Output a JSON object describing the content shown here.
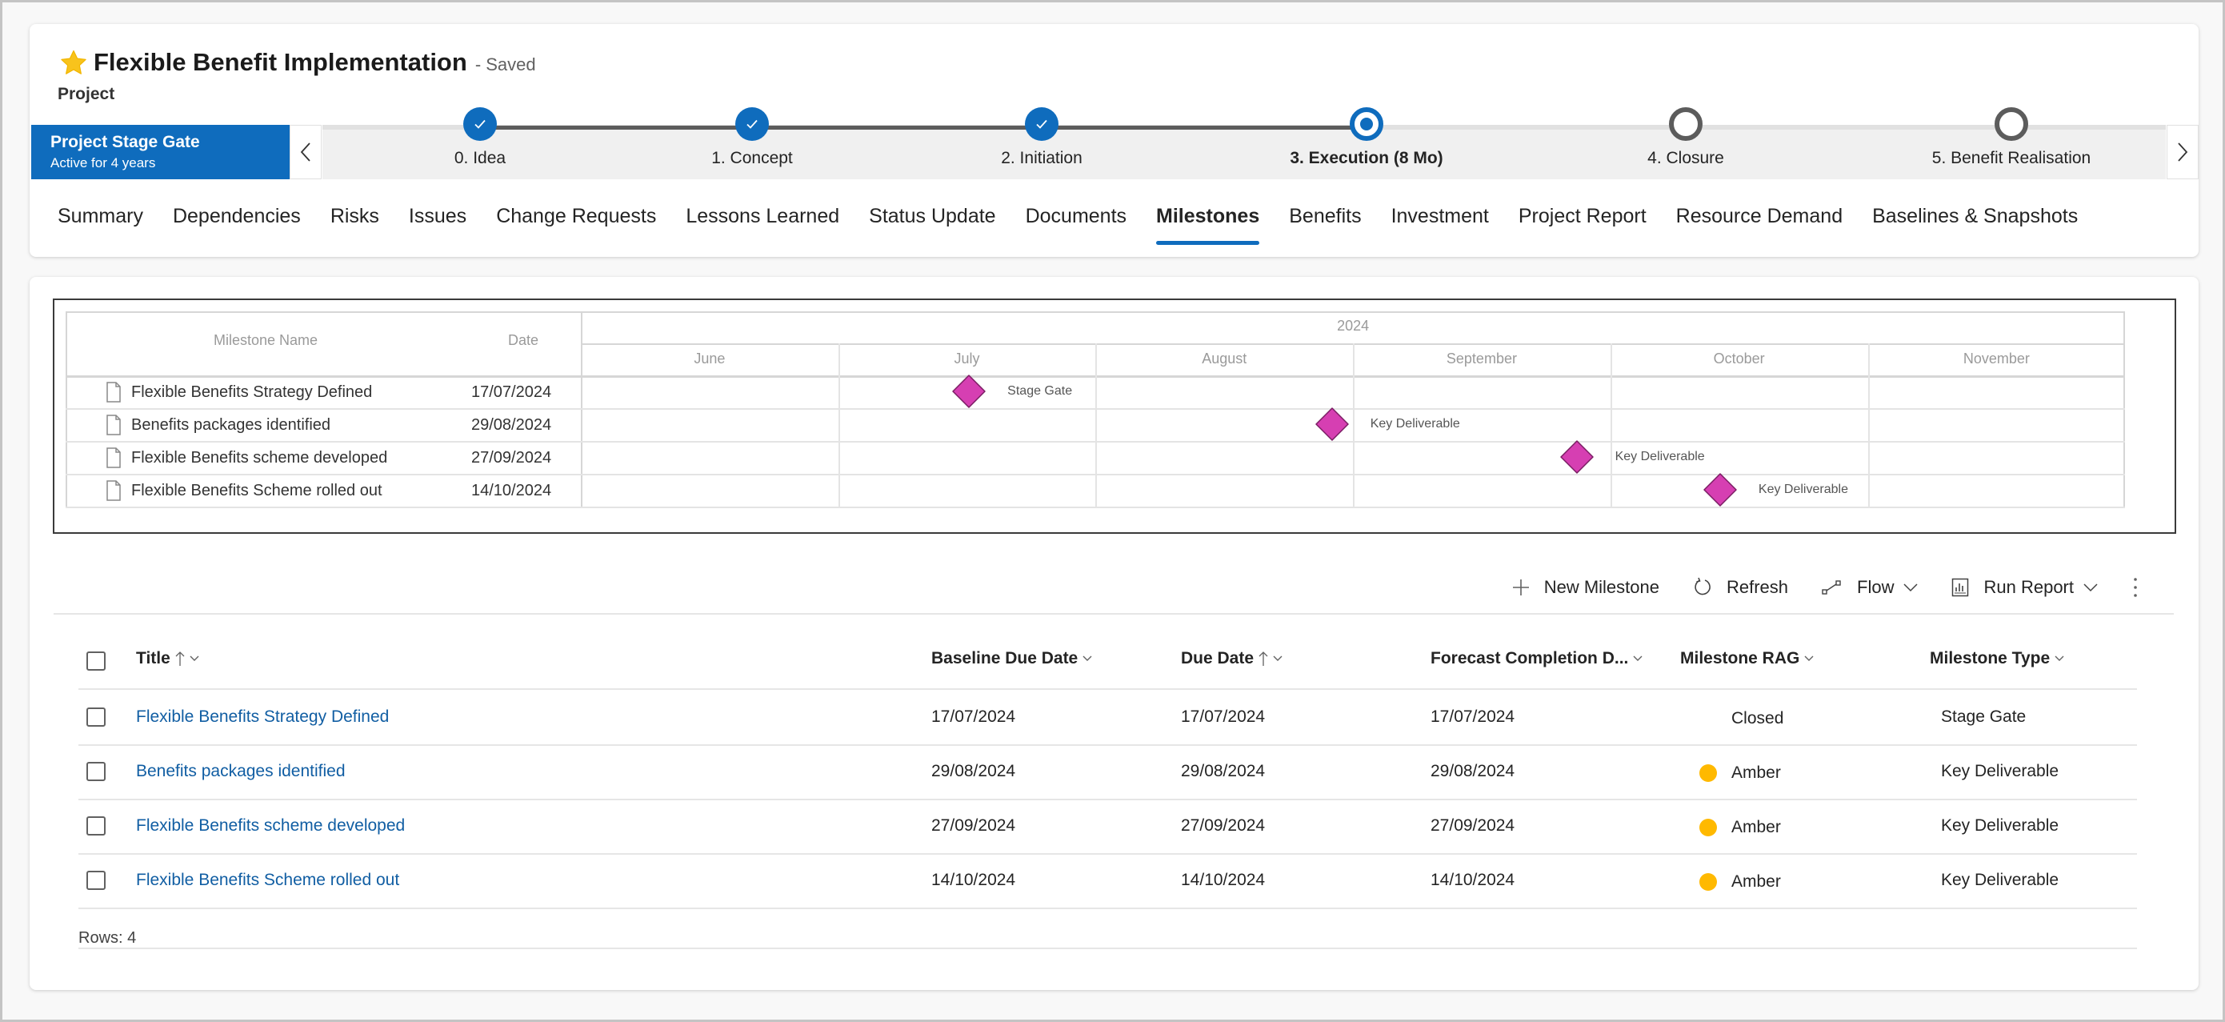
{
  "header": {
    "title": "Flexible Benefit Implementation",
    "save_status": "- Saved",
    "entity_type": "Project",
    "favorite_icon": "star-icon"
  },
  "stage_bar": {
    "process_name": "Project Stage Gate",
    "active_duration": "Active for 4 years",
    "stages": [
      {
        "label": "0. Idea",
        "status": "complete"
      },
      {
        "label": "1. Concept",
        "status": "complete"
      },
      {
        "label": "2. Initiation",
        "status": "complete"
      },
      {
        "label": "3. Execution  (8 Mo)",
        "status": "active"
      },
      {
        "label": "4. Closure",
        "status": "pending"
      },
      {
        "label": "5. Benefit Realisation",
        "status": "pending"
      }
    ],
    "colors": {
      "active": "#0f6cbd",
      "pending": "#5c5c5c"
    }
  },
  "tabs": [
    {
      "label": "Summary",
      "active": false
    },
    {
      "label": "Dependencies",
      "active": false
    },
    {
      "label": "Risks",
      "active": false
    },
    {
      "label": "Issues",
      "active": false
    },
    {
      "label": "Change Requests",
      "active": false
    },
    {
      "label": "Lessons Learned",
      "active": false
    },
    {
      "label": "Status Update",
      "active": false
    },
    {
      "label": "Documents",
      "active": false
    },
    {
      "label": "Milestones",
      "active": true
    },
    {
      "label": "Benefits",
      "active": false
    },
    {
      "label": "Investment",
      "active": false
    },
    {
      "label": "Project Report",
      "active": false
    },
    {
      "label": "Resource Demand",
      "active": false
    },
    {
      "label": "Baselines & Snapshots",
      "active": false
    }
  ],
  "gantt": {
    "col_name": "Milestone Name",
    "col_date": "Date",
    "year": "2024",
    "months": [
      "June",
      "July",
      "August",
      "September",
      "October",
      "November"
    ],
    "milestone_color": "#d63fb2",
    "items": [
      {
        "name": "Flexible Benefits Strategy Defined",
        "date": "17/07/2024",
        "day_of_range": 46,
        "tag": "Stage Gate"
      },
      {
        "name": "Benefits packages identified",
        "date": "29/08/2024",
        "day_of_range": 89,
        "tag": "Key Deliverable"
      },
      {
        "name": "Flexible Benefits scheme developed",
        "date": "27/09/2024",
        "day_of_range": 118,
        "tag": "Key Deliverable"
      },
      {
        "name": "Flexible Benefits Scheme rolled out",
        "date": "14/10/2024",
        "day_of_range": 135,
        "tag": "Key Deliverable"
      }
    ]
  },
  "commands": {
    "new": "New Milestone",
    "refresh": "Refresh",
    "flow": "Flow",
    "run_report": "Run Report"
  },
  "grid": {
    "columns": [
      {
        "label": "Title",
        "sort": "asc"
      },
      {
        "label": "Baseline Due Date",
        "sort": null
      },
      {
        "label": "Due Date",
        "sort": "asc"
      },
      {
        "label": "Forecast Completion D...",
        "sort": null
      },
      {
        "label": "Milestone RAG",
        "sort": null
      },
      {
        "label": "Milestone Type",
        "sort": null
      }
    ],
    "rows": [
      {
        "title": "Flexible Benefits Strategy Defined",
        "baseline": "17/07/2024",
        "due": "17/07/2024",
        "forecast": "17/07/2024",
        "rag": "Closed",
        "rag_color": null,
        "type": "Stage Gate"
      },
      {
        "title": "Benefits packages identified",
        "baseline": "29/08/2024",
        "due": "29/08/2024",
        "forecast": "29/08/2024",
        "rag": "Amber",
        "rag_color": "#ffb900",
        "type": "Key Deliverable"
      },
      {
        "title": "Flexible Benefits scheme developed",
        "baseline": "27/09/2024",
        "due": "27/09/2024",
        "forecast": "27/09/2024",
        "rag": "Amber",
        "rag_color": "#ffb900",
        "type": "Key Deliverable"
      },
      {
        "title": "Flexible Benefits Scheme rolled out",
        "baseline": "14/10/2024",
        "due": "14/10/2024",
        "forecast": "14/10/2024",
        "rag": "Amber",
        "rag_color": "#ffb900",
        "type": "Key Deliverable"
      }
    ],
    "footer": "Rows: 4"
  }
}
